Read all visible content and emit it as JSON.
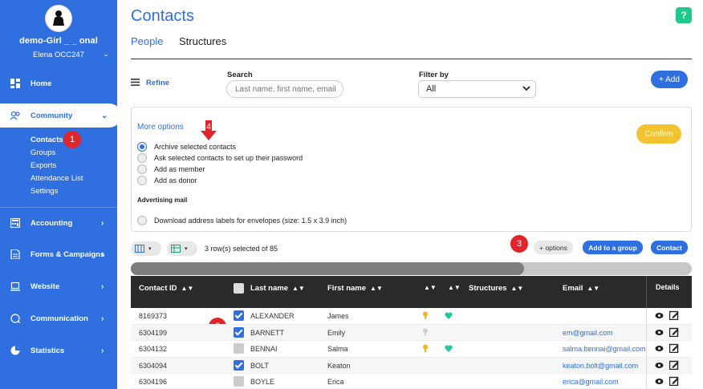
{
  "sidebar": {
    "org_name": "demo-Girl _ _ onal",
    "user_name": "Elena OCC247",
    "nav": {
      "home": "Home",
      "community": "Community",
      "accounting": "Accounting",
      "forms": "Forms & Campaigns",
      "website": "Website",
      "communication": "Communication",
      "statistics": "Statistics"
    },
    "community_sub": {
      "contacts": "Contacts",
      "groups": "Groups",
      "exports": "Exports",
      "attendance": "Attendance List",
      "settings": "Settings"
    }
  },
  "header": {
    "title": "Contacts",
    "help": "?",
    "tabs": {
      "people": "People",
      "structures": "Structures"
    }
  },
  "filters": {
    "refine_label": "Refine",
    "search_label": "Search",
    "search_placeholder": "Last name, first name, email",
    "filter_label": "Filter by",
    "filter_value": "All",
    "add_label": "+ Add"
  },
  "options_panel": {
    "more_options": "More options",
    "options": {
      "archive": "Archive selected contacts",
      "password": "Ask selected contacts to set up their password",
      "member": "Add as member",
      "donor": "Add as donor"
    },
    "advertising_mail": "Advertising mail",
    "labels_option": "Download address labels for envelopes (size: 1.5 x 3.9 inch)",
    "confirm": "Confirm"
  },
  "toolbar": {
    "selection": "3 row(s) selected of 85",
    "options_btn": "+ options",
    "add_group_btn": "Add to a group",
    "contact_btn": "Contact"
  },
  "markers": {
    "m1": "1",
    "m2": "2",
    "m3": "3",
    "m4": "4"
  },
  "table": {
    "headers": {
      "contact_id": "Contact ID",
      "last_name": "Last name",
      "first_name": "First name",
      "structures": "Structures",
      "email": "Email",
      "details": "Details"
    },
    "rows": [
      {
        "id": "8169373",
        "last": "ALEXANDER",
        "first": "James",
        "email": ""
      },
      {
        "id": "6304199",
        "last": "BARNETT",
        "first": "Emily",
        "email": "em@gmail.com"
      },
      {
        "id": "6304132",
        "last": "BENNAI",
        "first": "Salma",
        "email": "salma.bennai@gmail.com"
      },
      {
        "id": "6304094",
        "last": "BOLT",
        "first": "Keaton",
        "email": "keaton.bolt@gmail.com"
      },
      {
        "id": "6304196",
        "last": "BOYLE",
        "first": "Erica",
        "email": "erica@gmail.com"
      }
    ]
  },
  "colors": {
    "accent": "#2f6fe0",
    "confirm": "#f2c230",
    "marker": "#e0262b",
    "help": "#1ec98a"
  }
}
